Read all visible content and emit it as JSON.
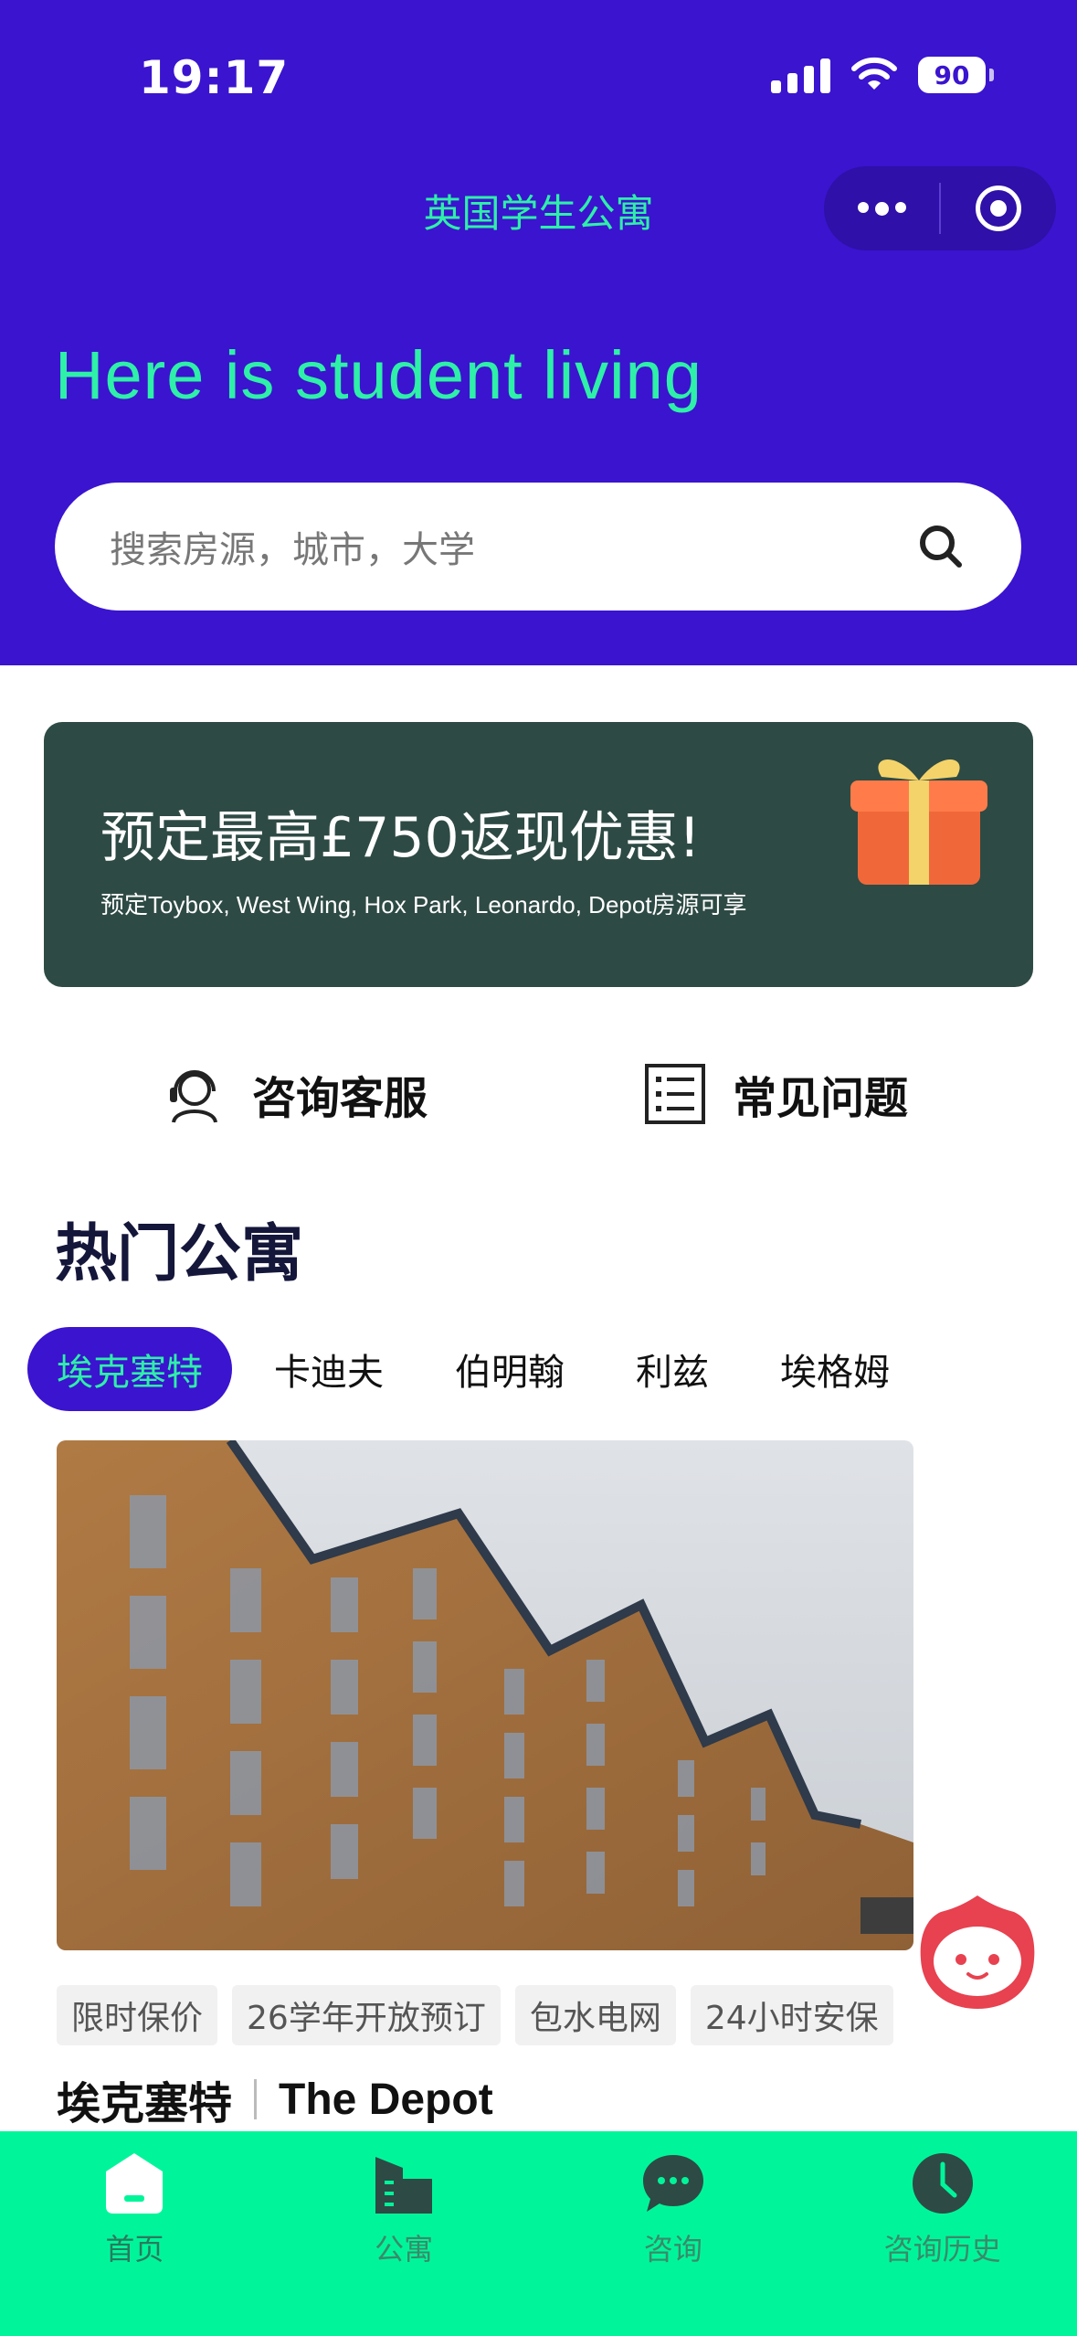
{
  "status_bar": {
    "time": "19:17",
    "battery": "90"
  },
  "nav": {
    "title": "英国学生公寓"
  },
  "hero": {
    "headline": "Here is student living"
  },
  "search": {
    "placeholder": "搜索房源，城市，大学"
  },
  "promo": {
    "title": "预定最高£750返现优惠!",
    "subtitle": "预定Toybox, West Wing, Hox Park, Leonardo, Depot房源可享"
  },
  "quick_links": [
    {
      "label": "咨询客服",
      "icon": "customer-service-icon"
    },
    {
      "label": "常见问题",
      "icon": "faq-list-icon"
    }
  ],
  "section": {
    "title": "热门公寓"
  },
  "city_tabs": [
    {
      "label": "埃克塞特",
      "active": true
    },
    {
      "label": "卡迪夫",
      "active": false
    },
    {
      "label": "伯明翰",
      "active": false
    },
    {
      "label": "利兹",
      "active": false
    },
    {
      "label": "埃格姆",
      "active": false
    }
  ],
  "apartment": {
    "tags": [
      "限时保价",
      "26学年开放预订",
      "包水电网",
      "24小时安保"
    ],
    "city": "埃克塞特",
    "name": "The Depot"
  },
  "tabbar": [
    {
      "label": "首页",
      "icon": "home-icon",
      "active": true
    },
    {
      "label": "公寓",
      "icon": "building-icon",
      "active": false
    },
    {
      "label": "咨询",
      "icon": "chat-bubble-icon",
      "active": false
    },
    {
      "label": "咨询历史",
      "icon": "clock-icon",
      "active": false
    }
  ],
  "colors": {
    "header_bg": "#3a14cf",
    "accent_green": "#2ef0a8",
    "promo_bg": "#2e4a44",
    "tabbar_bg": "#00f59a"
  }
}
